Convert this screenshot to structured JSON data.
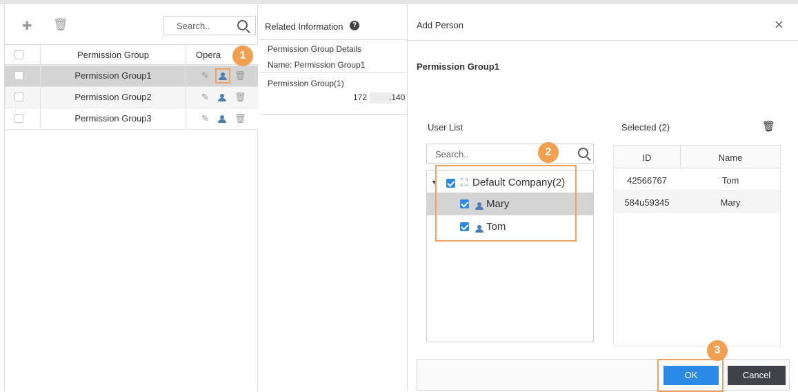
{
  "left_panel": {
    "search_placeholder": "Search..",
    "columns": {
      "group": "Permission Group",
      "operation": "Opera"
    },
    "rows": [
      {
        "name": "Permission Group1"
      },
      {
        "name": "Permission Group2"
      },
      {
        "name": "Permission Group3"
      }
    ]
  },
  "middle_panel": {
    "title": "Related Information",
    "details_title": "Permission Group Details",
    "details_name": "Name: Permission Group1",
    "group_count_label": "Permission Group(1)",
    "ip_prefix": "172",
    "ip_suffix": ".140"
  },
  "dialog": {
    "title": "Add Person",
    "close": "×",
    "group_name": "Permission Group1",
    "user_list_label": "User List",
    "search_placeholder": "Search..",
    "tree": {
      "company": "Default Company(2)",
      "users": [
        "Mary",
        "Tom"
      ]
    },
    "selected_label": "Selected (2)",
    "selected_columns": {
      "id": "ID",
      "name": "Name"
    },
    "selected_rows": [
      {
        "id": "42566767",
        "name": "Tom"
      },
      {
        "id": "584u59345",
        "name": "Mary"
      }
    ],
    "ok": "OK",
    "cancel": "Cancel"
  },
  "callouts": [
    "1",
    "2",
    "3"
  ],
  "colors": {
    "accent": "#2b8ae6",
    "callout": "#f0a050",
    "selected_row": "#d4d4d4",
    "cancel_btn": "#3d4348"
  }
}
